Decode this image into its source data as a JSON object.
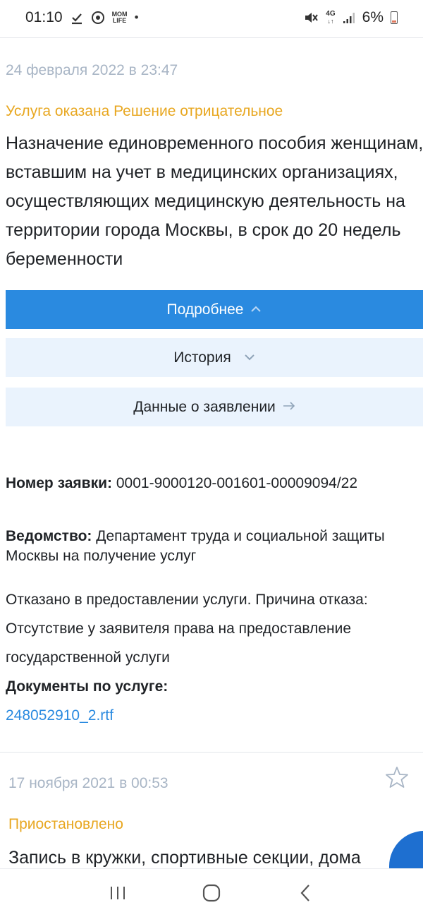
{
  "status_bar": {
    "time": "01:10",
    "icons": [
      "download-check-icon",
      "timer-app-icon",
      "momlife-icon",
      "dot-icon"
    ],
    "momlife_text": "MOM LIFE",
    "network": "4G",
    "battery": "6%"
  },
  "card1": {
    "date": "24 февраля 2022 в 23:47",
    "status": "Услуга оказана Решение отрицательное",
    "title": "Назначение единовременного пособия женщинам, вставшим на учет в медицинских организациях, осуществляющих медицинскую деятельность на территории города Москвы, в срок до 20 недель беременности",
    "btn_details": "Подробнее",
    "btn_history": "История",
    "btn_application": "Данные о заявлении",
    "order_label": "Номер заявки:",
    "order_value": "0001-9000120-001601-00009094/22",
    "dept_label": "Ведомство:",
    "dept_value": "Департамент труда и социальной защиты Москвы на получение услуг",
    "refusal_text": "Отказано в предоставлении услуги. Причина отказа: Отсутствие у заявителя права на предоставление государственной услуги",
    "docs_label": "Документы по услуге:",
    "doc_file": "248052910_2.rtf"
  },
  "card2": {
    "date": "17 ноября 2021 в 00:53",
    "status": "Приостановлено",
    "title": "Запись в кружки, спортивные секции, дома"
  },
  "colors": {
    "accent": "#2a8ae0",
    "status_orange": "#e8a720",
    "date_grey": "#a8b5c5",
    "light_button": "#eaf3fd"
  },
  "nav": [
    "recent-apps-icon",
    "home-icon",
    "back-icon"
  ]
}
